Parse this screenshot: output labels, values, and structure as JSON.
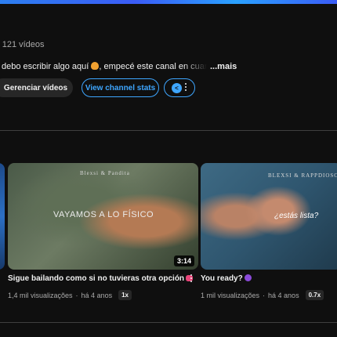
{
  "channel": {
    "meta": "· 121 vídeos",
    "description": "debo escribir algo aquí",
    "description_rest": ", empecé este canal en cuarenteno",
    "more_label": "...mais"
  },
  "actions": {
    "manage_label": "Gerenciar vídeos",
    "stats_label": "View channel stats"
  },
  "videos": [
    {
      "title": "Sigue bailando como si no tuvieras otra opción",
      "views": "1,4 mil visualizações",
      "age": "há 4 anos",
      "speed": "1x",
      "duration": "3:14",
      "watermark": "Blexsi & Pandita",
      "overlay_text": "VAYAMOS A LO FÍSICO"
    },
    {
      "title": "You ready?",
      "views": "1 mil visualizações",
      "age": "há 4 anos",
      "speed": "0.7x",
      "watermark": "BLEXSI & RAPPDIOSO",
      "overlay_text": "¿estás lista?"
    }
  ],
  "colors": {
    "accent": "#3ea6ff",
    "background": "#0f0f0f",
    "chip": "#272727"
  }
}
